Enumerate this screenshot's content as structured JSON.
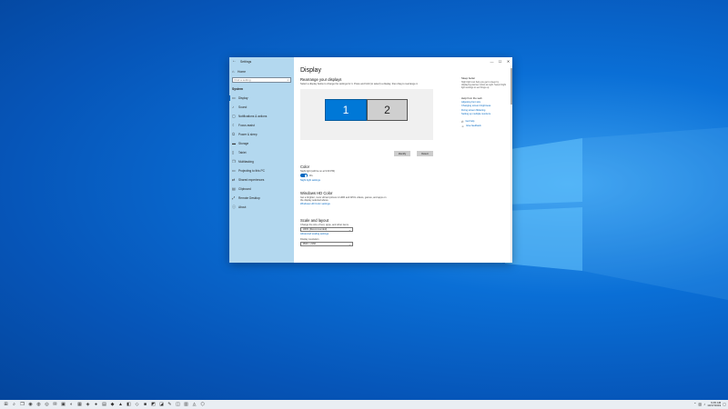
{
  "window": {
    "title": "Settings",
    "controls": {
      "minimize": "—",
      "maximize": "☐",
      "close": "✕"
    }
  },
  "sidebar": {
    "home_label": "Home",
    "search_placeholder": "Find a setting",
    "section": "System",
    "items": [
      {
        "label": "Display",
        "icon": "▭"
      },
      {
        "label": "Sound",
        "icon": "♪"
      },
      {
        "label": "Notifications & actions",
        "icon": "▢"
      },
      {
        "label": "Focus assist",
        "icon": "☾"
      },
      {
        "label": "Power & sleep",
        "icon": "⏻"
      },
      {
        "label": "Storage",
        "icon": "▬"
      },
      {
        "label": "Tablet",
        "icon": "▯"
      },
      {
        "label": "Multitasking",
        "icon": "❐"
      },
      {
        "label": "Projecting to this PC",
        "icon": "▭"
      },
      {
        "label": "Shared experiences",
        "icon": "⇄"
      },
      {
        "label": "Clipboard",
        "icon": "▤"
      },
      {
        "label": "Remote Desktop",
        "icon": "⤢"
      },
      {
        "label": "About",
        "icon": "ⓘ"
      }
    ]
  },
  "main": {
    "title": "Display",
    "rearrange": {
      "heading": "Rearrange your displays",
      "description": "Select a display below to change the settings for it. Press and hold (or select) a display, then drag to rearrange it.",
      "monitor1": "1",
      "monitor2": "2",
      "identify_label": "Identify",
      "detect_label": "Detect"
    },
    "color": {
      "heading": "Color",
      "night_light_label": "Night light (will be on at 9:00 PM)",
      "toggle_state": "On",
      "settings_link": "Night light settings"
    },
    "hdr": {
      "heading": "Windows HD Color",
      "description": "Get a brighter, more vibrant picture in HDR and WCG videos, games, and apps on the display selected above.",
      "link": "Windows HD Color settings"
    },
    "scale": {
      "heading": "Scale and layout",
      "scale_label": "Change the size of text, apps, and other items",
      "scale_value": "100% (Recommended)",
      "advanced_link": "Advanced scaling settings",
      "resolution_label": "Display resolution",
      "resolution_value": "3840 × 2160"
    }
  },
  "right_panel": {
    "sleep_heading": "Sleep better",
    "sleep_text": "Night light can help you get to sleep by displaying warmer colors at night. Select Night light settings to set things up.",
    "web_heading": "Help from the web",
    "web_links": [
      "Adjusting font size",
      "Changing screen brightness",
      "Fixing screen flickering",
      "Setting up multiple monitors"
    ],
    "get_help": "Get help",
    "give_feedback": "Give feedback"
  },
  "taskbar": {
    "icons": [
      "⊞",
      "⌕",
      "❐",
      "◉",
      "◍",
      "◎",
      "✉",
      "▣",
      "◐",
      "▦",
      "◈",
      "●",
      "▤",
      "◆",
      "▲",
      "◧",
      "◇",
      "■",
      "◩",
      "◪",
      "✎",
      "◫",
      "▥",
      "◬",
      "⬡"
    ],
    "time": "9:45 AM",
    "date": "10/17/2019"
  }
}
